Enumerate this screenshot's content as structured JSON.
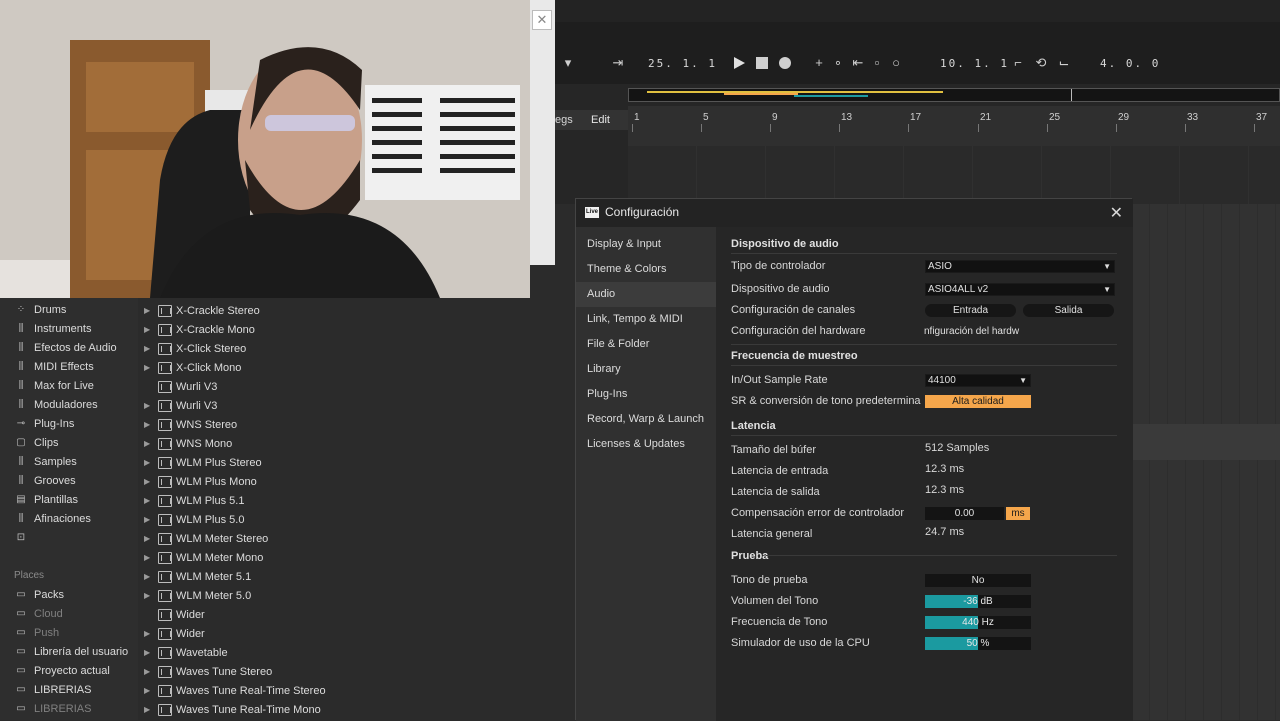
{
  "transport": {
    "position": "25.  1.  1",
    "loop_start": "10.  1.  1",
    "loop_length": "4.  0.  0"
  },
  "arrangement": {
    "tab_legs": "egs",
    "tab_edit": "Edit",
    "bars": [
      "1",
      "5",
      "9",
      "13",
      "17",
      "21",
      "25",
      "29",
      "33",
      "37"
    ]
  },
  "sidebar": {
    "categories": [
      {
        "label": "Drums",
        "icon": "drums-icon"
      },
      {
        "label": "Instruments",
        "icon": "instruments-icon"
      },
      {
        "label": "Efectos de Audio",
        "icon": "audio-effects-icon"
      },
      {
        "label": "MIDI Effects",
        "icon": "midi-effects-icon"
      },
      {
        "label": "Max for Live",
        "icon": "max-for-live-icon"
      },
      {
        "label": "Moduladores",
        "icon": "modulators-icon"
      },
      {
        "label": "Plug-Ins",
        "icon": "plugins-icon"
      },
      {
        "label": "Clips",
        "icon": "clips-icon"
      },
      {
        "label": "Samples",
        "icon": "samples-icon"
      },
      {
        "label": "Grooves",
        "icon": "grooves-icon"
      },
      {
        "label": "Plantillas",
        "icon": "templates-icon"
      },
      {
        "label": "Afinaciones",
        "icon": "tunings-icon"
      }
    ],
    "places_label": "Places",
    "places": [
      {
        "label": "Packs",
        "dim": false
      },
      {
        "label": "Cloud",
        "dim": true
      },
      {
        "label": "Push",
        "dim": true
      },
      {
        "label": "Librería del usuario",
        "dim": false
      },
      {
        "label": "Proyecto actual",
        "dim": false
      },
      {
        "label": "LIBRERIAS",
        "dim": false
      },
      {
        "label": "LIBRERIAS",
        "dim": true
      }
    ]
  },
  "files": [
    {
      "label": "X-Crackle Stereo",
      "arrow": true
    },
    {
      "label": "X-Crackle Mono",
      "arrow": true
    },
    {
      "label": "X-Click Stereo",
      "arrow": true
    },
    {
      "label": "X-Click Mono",
      "arrow": true
    },
    {
      "label": "Wurli V3",
      "arrow": false
    },
    {
      "label": "Wurli V3",
      "arrow": true
    },
    {
      "label": "WNS Stereo",
      "arrow": true
    },
    {
      "label": "WNS Mono",
      "arrow": true
    },
    {
      "label": "WLM Plus Stereo",
      "arrow": true
    },
    {
      "label": "WLM Plus Mono",
      "arrow": true
    },
    {
      "label": "WLM Plus 5.1",
      "arrow": true
    },
    {
      "label": "WLM Plus 5.0",
      "arrow": true
    },
    {
      "label": "WLM Meter Stereo",
      "arrow": true
    },
    {
      "label": "WLM Meter Mono",
      "arrow": true
    },
    {
      "label": "WLM Meter 5.1",
      "arrow": true
    },
    {
      "label": "WLM Meter 5.0",
      "arrow": true
    },
    {
      "label": "Wider",
      "arrow": false
    },
    {
      "label": "Wider",
      "arrow": true
    },
    {
      "label": "Wavetable",
      "arrow": true
    },
    {
      "label": "Waves Tune Stereo",
      "arrow": true
    },
    {
      "label": "Waves Tune Real-Time Stereo",
      "arrow": true
    },
    {
      "label": "Waves Tune Real-Time Mono",
      "arrow": true
    }
  ],
  "dialog": {
    "logo": "Live",
    "title": "Configuración",
    "nav": [
      {
        "label": "Display & Input",
        "active": false
      },
      {
        "label": "Theme & Colors",
        "active": false
      },
      {
        "label": "Audio",
        "active": true
      },
      {
        "label": "Link, Tempo & MIDI",
        "active": false
      },
      {
        "label": "File & Folder",
        "active": false
      },
      {
        "label": "Library",
        "active": false
      },
      {
        "label": "Plug-Ins",
        "active": false
      },
      {
        "label": "Record, Warp & Launch",
        "active": false
      },
      {
        "label": "Licenses & Updates",
        "active": false
      }
    ],
    "device": {
      "section": "Dispositivo de audio",
      "driver_label": "Tipo de controlador",
      "driver_value": "ASIO",
      "device_label": "Dispositivo de audio",
      "device_value": "ASIO4ALL v2",
      "channels_label": "Configuración de canales",
      "input_btn": "Entrada",
      "output_btn": "Salida",
      "hardware_label": "Configuración del hardware",
      "hardware_btn": "nfiguración del hardw"
    },
    "sample_rate": {
      "section": "Frecuencia de muestreo",
      "rate_label": "In/Out Sample Rate",
      "rate_value": "44100",
      "sr_label": "SR & conversión de tono predetermina",
      "sr_value": "Alta calidad"
    },
    "latency": {
      "section": "Latencia",
      "buffer_label": "Tamaño del búfer",
      "buffer_value": "512 Samples",
      "in_label": "Latencia de entrada",
      "in_value": "12.3 ms",
      "out_label": "Latencia de salida",
      "out_value": "12.3 ms",
      "comp_label": "Compensación error de controlador",
      "comp_value": "0.00",
      "comp_unit": "ms",
      "total_label": "Latencia general",
      "total_value": "24.7 ms"
    },
    "test": {
      "section": "Prueba",
      "tone_label": "Tono de prueba",
      "tone_value": "No",
      "volume_label": "Volumen del Tono",
      "volume_value": "-36 dB",
      "volume_fill": 0.5,
      "freq_label": "Frecuencia de Tono",
      "freq_value": "440 Hz",
      "freq_fill": 0.5,
      "cpu_label": "Simulador de uso de la CPU",
      "cpu_value": "50 %",
      "cpu_fill": 0.5
    }
  },
  "colors": {
    "accent_orange": "#f5a64b",
    "accent_teal": "#1b9aa0"
  }
}
